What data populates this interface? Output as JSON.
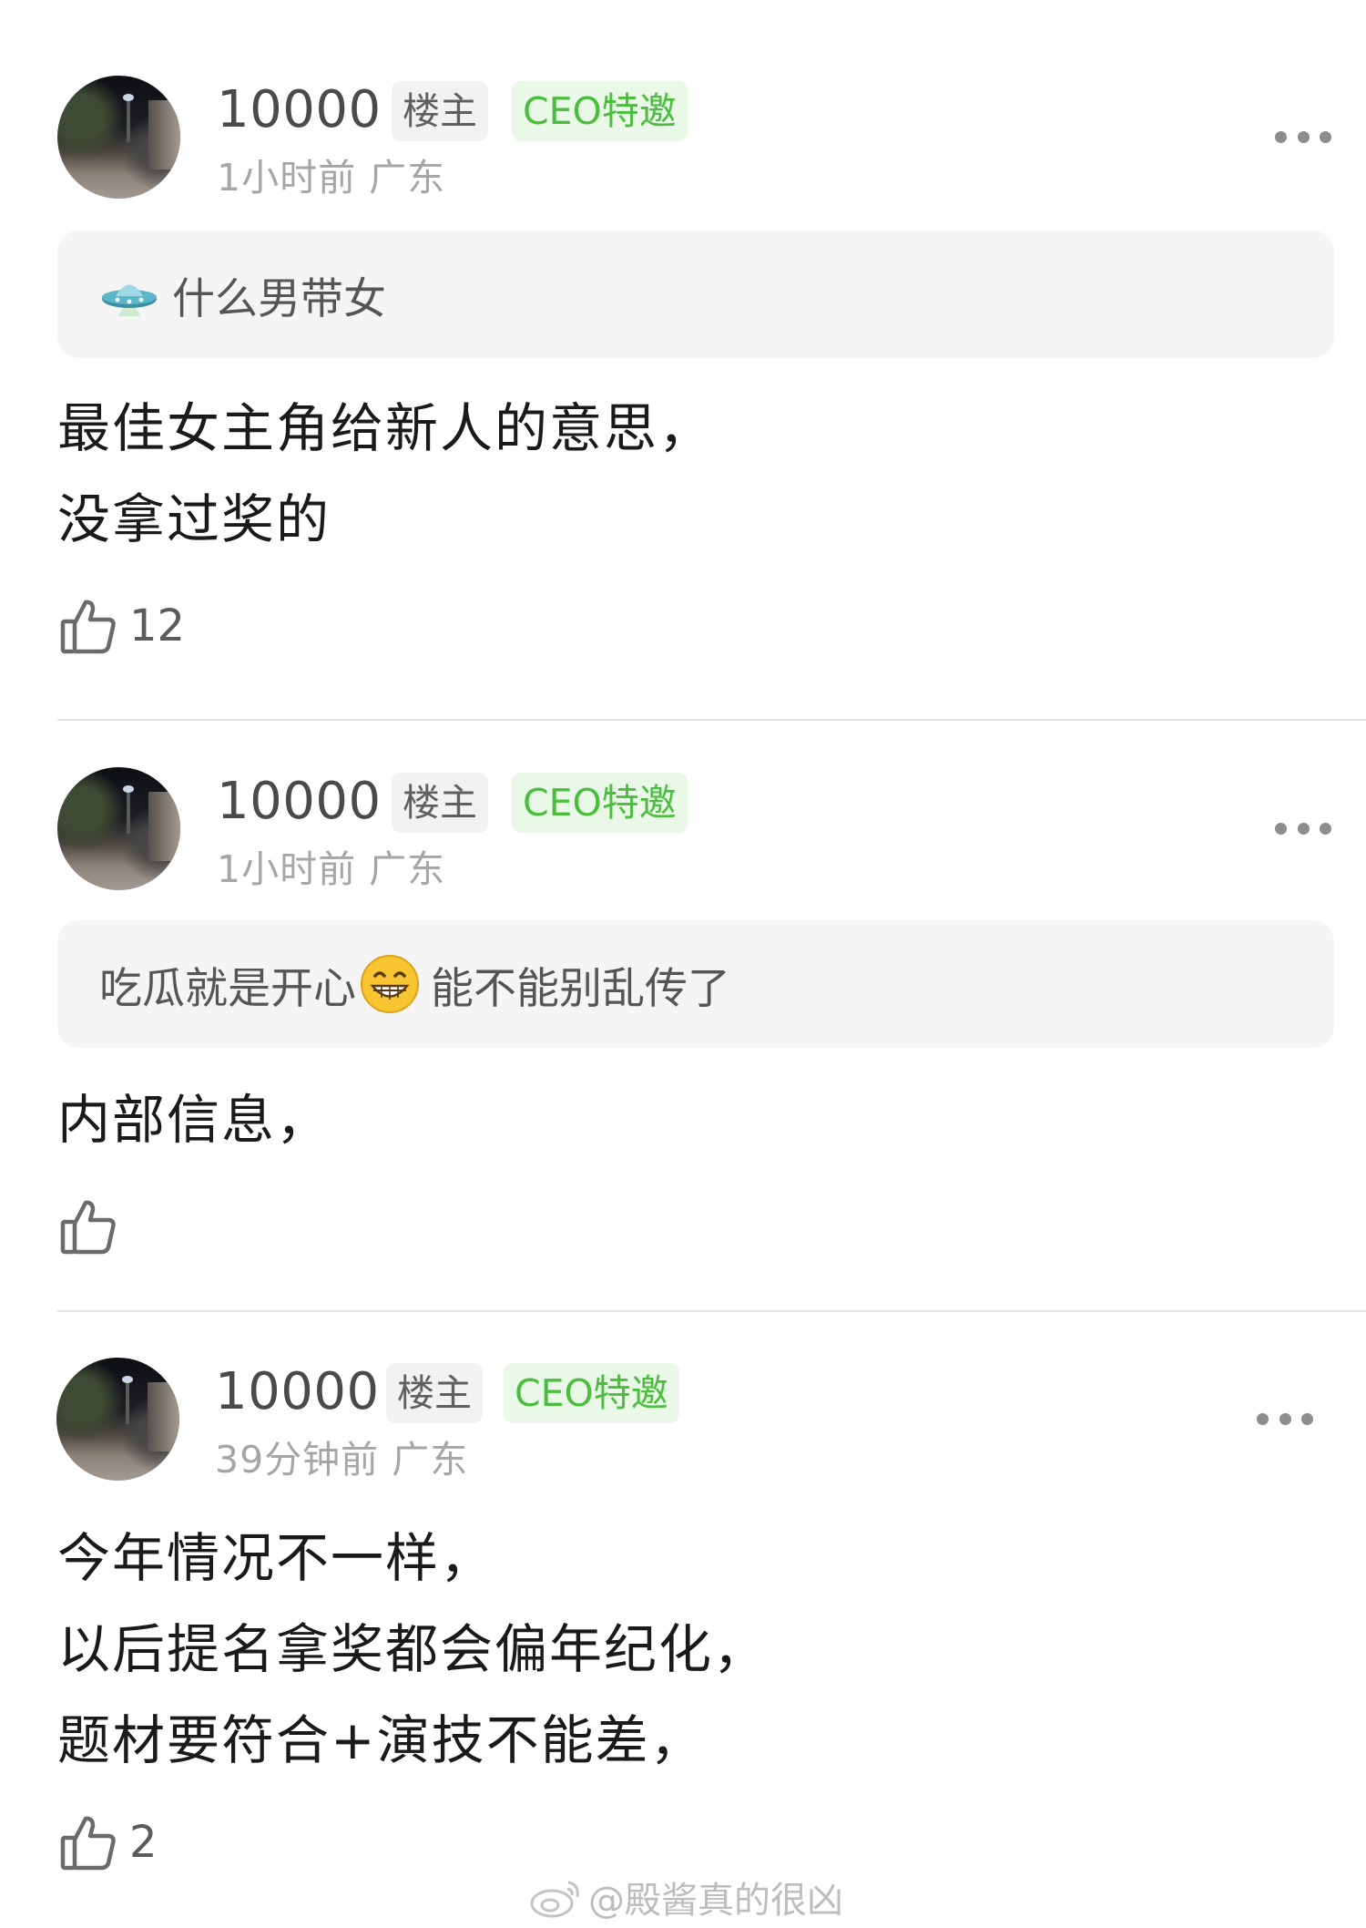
{
  "comments": [
    {
      "username": "10000",
      "badge_op": "楼主",
      "badge_ceo": "CEO特邀",
      "time": "1小时前",
      "location": "广东",
      "quote": {
        "text": "什么男带女",
        "icon": "ufo-icon"
      },
      "lines": [
        "最佳女主角给新人的意思，",
        "没拿过奖的"
      ],
      "likes": "12"
    },
    {
      "username": "10000",
      "badge_op": "楼主",
      "badge_ceo": "CEO特邀",
      "time": "1小时前",
      "location": "广东",
      "quote": {
        "text_before": "吃瓜就是开心",
        "emoji": "grinning-face-icon",
        "text_after": "能不能别乱传了"
      },
      "lines": [
        "内部信息，"
      ],
      "likes": ""
    },
    {
      "username": "10000",
      "badge_op": "楼主",
      "badge_ceo": "CEO特邀",
      "time": "39分钟前",
      "location": "广东",
      "lines": [
        "今年情况不一样，",
        "以后提名拿奖都会偏年纪化，",
        "题材要符合+演技不能差，"
      ],
      "likes": "2"
    }
  ],
  "watermark": "@殿酱真的很凶",
  "colors": {
    "ceo_badge_text": "#4cbd3f",
    "ceo_badge_bg": "#eaf8e8",
    "quote_bg": "#f5f5f5"
  }
}
